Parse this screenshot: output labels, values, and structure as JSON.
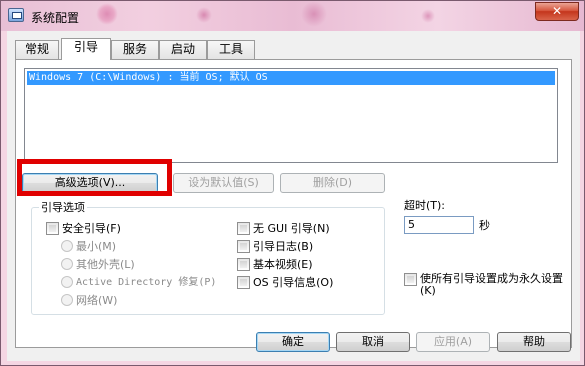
{
  "window": {
    "title": "系统配置",
    "close_symbol": "✕"
  },
  "tabs": [
    {
      "label": "常规"
    },
    {
      "label": "引导"
    },
    {
      "label": "服务"
    },
    {
      "label": "启动"
    },
    {
      "label": "工具"
    }
  ],
  "boot_list": {
    "items": [
      "Windows 7 (C:\\Windows) : 当前 OS; 默认 OS"
    ]
  },
  "buttons": {
    "advanced": "高级选项(V)...",
    "set_default": "设为默认值(S)",
    "delete": "删除(D)"
  },
  "boot_options": {
    "title": "引导选项",
    "safe_boot": "安全引导(F)",
    "minimal": "最小(M)",
    "alternate_shell": "其他外壳(L)",
    "active_directory_repair": "Active Directory 修复(P)",
    "network": "网络(W)",
    "no_gui_boot": "无 GUI 引导(N)",
    "boot_log": "引导日志(B)",
    "base_video": "基本视频(E)",
    "os_boot_info": "OS 引导信息(O)"
  },
  "timeout": {
    "label": "超时(T):",
    "value": "5",
    "unit": "秒"
  },
  "make_permanent": "使所有引导设置成为永久设置(K)",
  "footer": {
    "ok": "确定",
    "cancel": "取消",
    "apply": "应用(A)",
    "help": "帮助"
  },
  "colors": {
    "highlight_box": "#e00000",
    "selection": "#3399ff"
  }
}
